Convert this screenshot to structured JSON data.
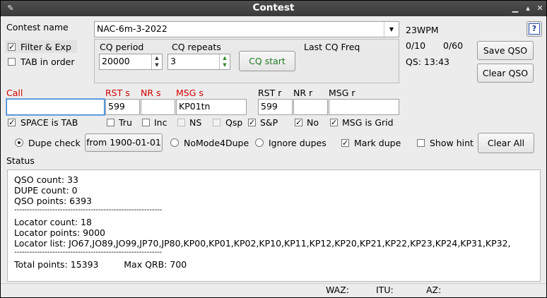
{
  "window": {
    "title": "Contest"
  },
  "top": {
    "contest_name_label": "Contest name",
    "contest_name_value": "NAC-6m-3-2022",
    "filter_exp_label": "Filter & Exp",
    "tab_in_order_label": "TAB in order",
    "wpm": "23WPM",
    "count_a": "0/10",
    "count_b": "0/60",
    "qs": "QS: 13:43",
    "help_label": "?"
  },
  "cq": {
    "period_label": "CQ period",
    "period_value": "20000",
    "repeats_label": "CQ repeats",
    "repeats_value": "3",
    "start_label": "CQ start",
    "last_freq_label": "Last CQ Freq"
  },
  "buttons": {
    "save_qso": "Save QSO",
    "clear_qso": "Clear QSO",
    "clear_all": "Clear All",
    "dupe_from": "from 1900-01-01"
  },
  "entry": {
    "call_label": "Call",
    "rst_s_label": "RST s",
    "nr_s_label": "NR s",
    "msg_s_label": "MSG s",
    "rst_r_label": "RST r",
    "nr_r_label": "NR r",
    "msg_r_label": "MSG r",
    "call_value": "",
    "rst_s_value": "599",
    "nr_s_value": "",
    "msg_s_value": "KP01tn",
    "rst_r_value": "599",
    "nr_r_value": "",
    "msg_r_value": ""
  },
  "checks": {
    "space_is_tab": "SPACE is TAB",
    "tru": "Tru",
    "inc": "Inc",
    "ns": "NS",
    "qsp": "Qsp",
    "sp": "S&P",
    "no": "No",
    "msg_is_grid": "MSG is Grid"
  },
  "dupe": {
    "dupe_check": "Dupe check",
    "no_mode": "NoMode4Dupe",
    "ignore": "Ignore dupes",
    "mark": "Mark dupe",
    "show_hint": "Show hint"
  },
  "status": {
    "label": "Status",
    "lines": [
      "QSO count: 33",
      "DUPE count: 0",
      "QSO points: 6393",
      "----------------------------------------------------------",
      "Locator count: 18",
      "Locator points: 9000",
      "Locator list: JO67,JO89,JO99,JP70,JP80,KP00,KP01,KP02,KP10,KP11,KP12,KP20,KP21,KP22,KP23,KP24,KP31,KP32,",
      "----------------------------------------------------------",
      "Total points: 15393         Max QRB: 700"
    ]
  },
  "footer": {
    "waz": "WAZ:",
    "itu": "ITU:",
    "az": "AZ:"
  }
}
